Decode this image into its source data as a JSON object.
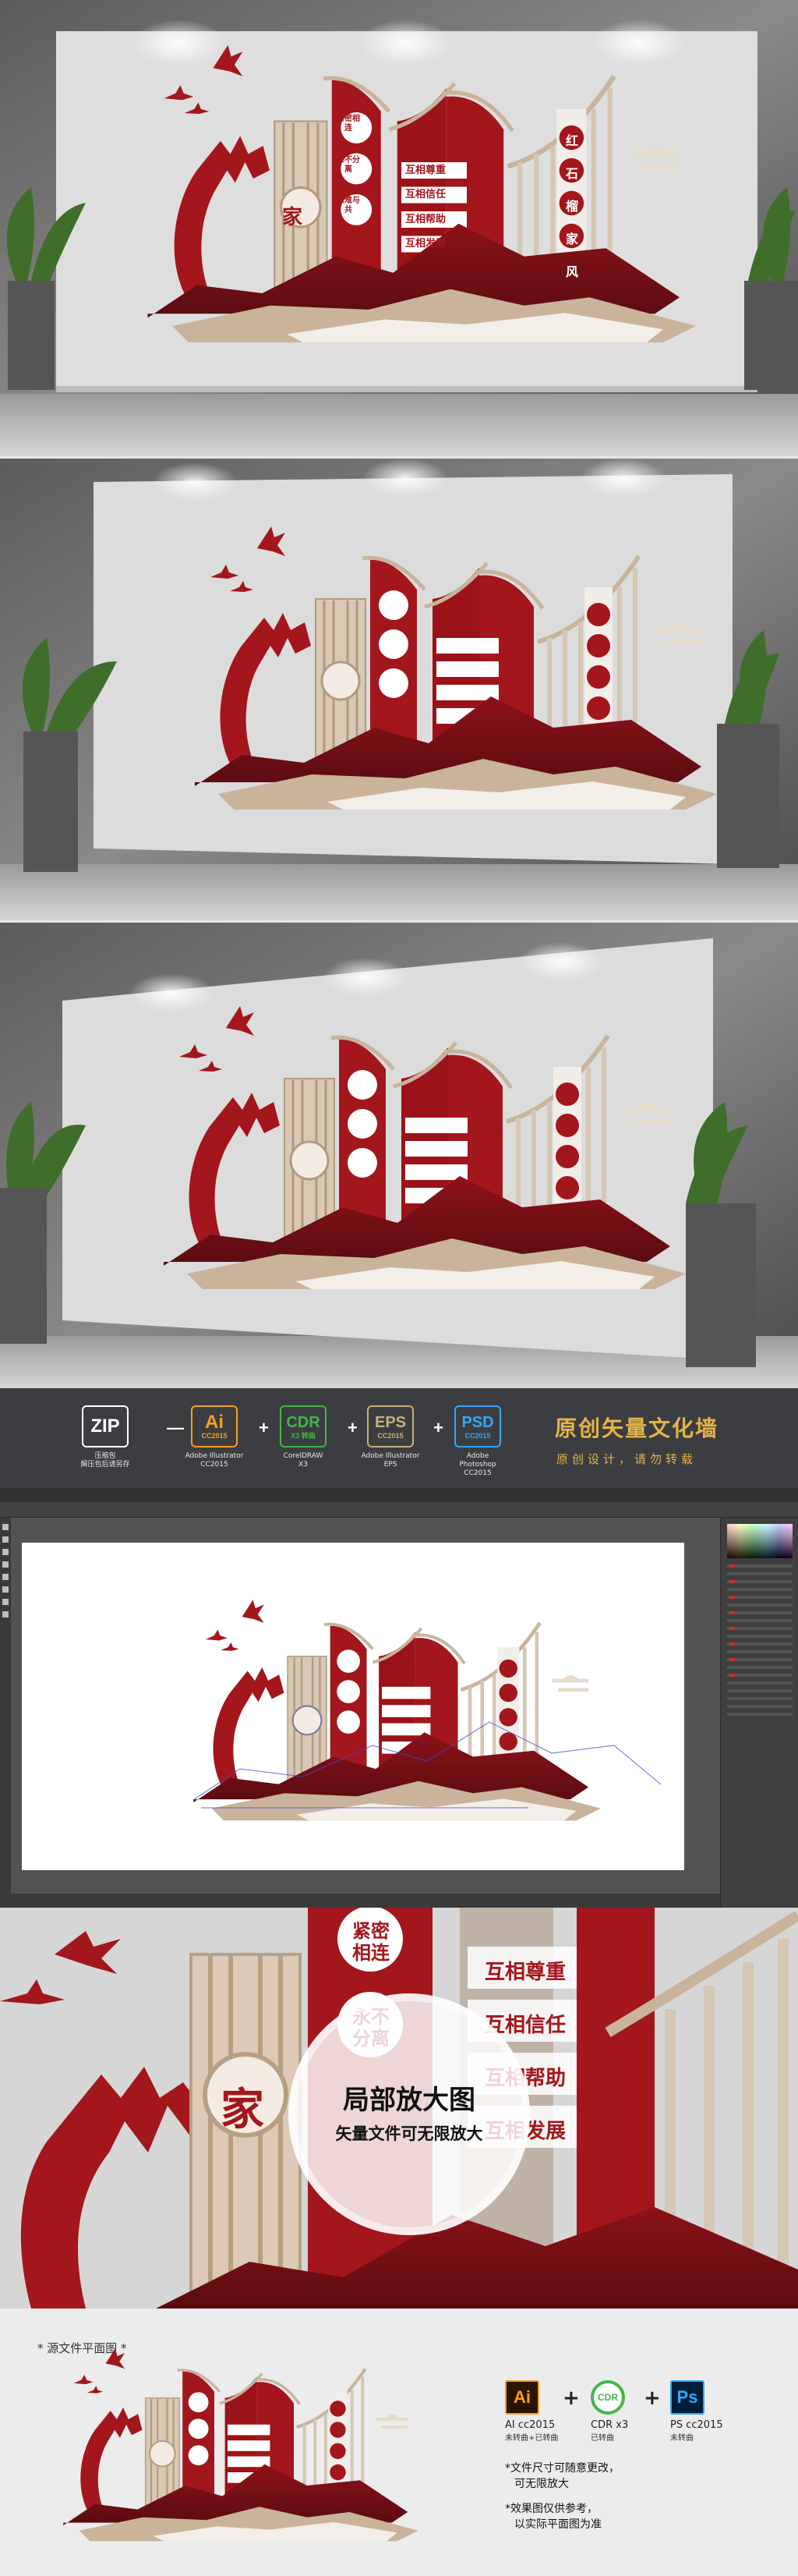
{
  "scene": {
    "char_home": "家",
    "circle_labels": [
      "紧密相连",
      "永不分离",
      "患难与共"
    ],
    "bars": [
      "互相尊重",
      "互相信任",
      "互相帮助",
      "互相发展"
    ],
    "motto": [
      "红",
      "石",
      "榴",
      "家",
      "风"
    ]
  },
  "formats": [
    {
      "icon": "ZIP",
      "sub": "",
      "cap1": "压缩包",
      "cap2": "解压包后请另存"
    },
    {
      "icon": "Ai",
      "sub": "CC2015",
      "cap1": "Adobe Illustrator",
      "cap2": "CC2015"
    },
    {
      "icon": "CDR",
      "sub": "X3 转曲",
      "cap1": "CorelDRAW",
      "cap2": "X3"
    },
    {
      "icon": "EPS",
      "sub": "CC2015",
      "cap1": "Adobe Illustrator",
      "cap2": "EPS"
    },
    {
      "icon": "PSD",
      "sub": "CC2015",
      "cap1": "Adobe Photoshop",
      "cap2": "CC2015"
    }
  ],
  "ops": [
    "—",
    "+",
    "+",
    "+"
  ],
  "brand": {
    "title": "原创矢量文化墙",
    "subtitle": "原创设计，请勿转载"
  },
  "zoom": {
    "title": "局部放大图",
    "subtitle": "矢量文件可无限放大"
  },
  "bottom": {
    "source_label": "* 源文件平面图 *",
    "software": [
      {
        "icon": "Ai",
        "cap1": "AI cc2015",
        "cap2": "未转曲+已转曲"
      },
      {
        "icon": "CDR",
        "cap1": "CDR x3",
        "cap2": "已转曲"
      },
      {
        "icon": "Ps",
        "cap1": "PS cc2015",
        "cap2": "未转曲"
      }
    ],
    "notes": [
      "*文件尺寸可随意更改，",
      "可无限放大",
      "*效果图仅供参考，",
      "以实际平面图为准"
    ]
  },
  "colors": {
    "red": "#a3161c",
    "dark_red": "#6e0f13",
    "beige": "#c9b39b",
    "gold": "#e3b24a"
  }
}
